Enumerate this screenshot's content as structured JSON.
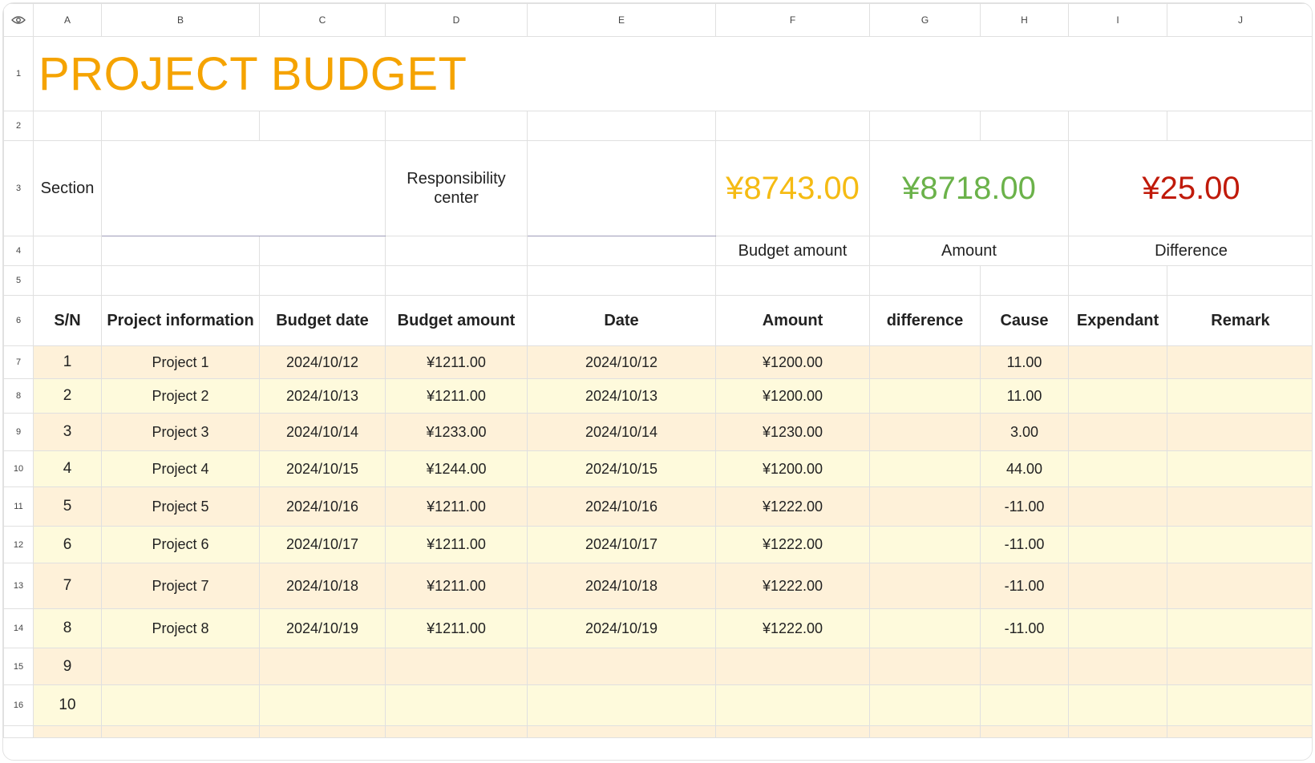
{
  "columns": [
    "A",
    "B",
    "C",
    "D",
    "E",
    "F",
    "G",
    "H",
    "I",
    "J"
  ],
  "row_numbers": [
    "1",
    "2",
    "3",
    "4",
    "5",
    "6",
    "7",
    "8",
    "9",
    "10",
    "11",
    "12",
    "13",
    "14",
    "15",
    "16"
  ],
  "sheet": {
    "title": "PROJECT BUDGET",
    "section_label": "Section",
    "responsibility_label": "Responsibility center",
    "summary": {
      "budget_amount_value": "¥8743.00",
      "amount_value": "¥8718.00",
      "difference_value": "¥25.00",
      "budget_amount_label": "Budget amount",
      "amount_label": "Amount",
      "difference_label": "Difference"
    },
    "headers": [
      "S/N",
      "Project information",
      "Budget date",
      "Budget amount",
      "Date",
      "Amount",
      "difference",
      "Cause",
      "Expendant",
      "Remark"
    ],
    "rows": [
      {
        "sn": "1",
        "project": "Project 1",
        "budget_date": "2024/10/12",
        "budget_amount": "¥1211.00",
        "date": "2024/10/12",
        "amount": "¥1200.00",
        "difference": "",
        "cause": "11.00",
        "expendant": "",
        "remark": ""
      },
      {
        "sn": "2",
        "project": "Project 2",
        "budget_date": "2024/10/13",
        "budget_amount": "¥1211.00",
        "date": "2024/10/13",
        "amount": "¥1200.00",
        "difference": "",
        "cause": "11.00",
        "expendant": "",
        "remark": ""
      },
      {
        "sn": "3",
        "project": "Project 3",
        "budget_date": "2024/10/14",
        "budget_amount": "¥1233.00",
        "date": "2024/10/14",
        "amount": "¥1230.00",
        "difference": "",
        "cause": "3.00",
        "expendant": "",
        "remark": ""
      },
      {
        "sn": "4",
        "project": "Project 4",
        "budget_date": "2024/10/15",
        "budget_amount": "¥1244.00",
        "date": "2024/10/15",
        "amount": "¥1200.00",
        "difference": "",
        "cause": "44.00",
        "expendant": "",
        "remark": ""
      },
      {
        "sn": "5",
        "project": "Project 5",
        "budget_date": "2024/10/16",
        "budget_amount": "¥1211.00",
        "date": "2024/10/16",
        "amount": "¥1222.00",
        "difference": "",
        "cause": "-11.00",
        "expendant": "",
        "remark": ""
      },
      {
        "sn": "6",
        "project": "Project 6",
        "budget_date": "2024/10/17",
        "budget_amount": "¥1211.00",
        "date": "2024/10/17",
        "amount": "¥1222.00",
        "difference": "",
        "cause": "-11.00",
        "expendant": "",
        "remark": ""
      },
      {
        "sn": "7",
        "project": "Project 7",
        "budget_date": "2024/10/18",
        "budget_amount": "¥1211.00",
        "date": "2024/10/18",
        "amount": "¥1222.00",
        "difference": "",
        "cause": "-11.00",
        "expendant": "",
        "remark": ""
      },
      {
        "sn": "8",
        "project": "Project 8",
        "budget_date": "2024/10/19",
        "budget_amount": "¥1211.00",
        "date": "2024/10/19",
        "amount": "¥1222.00",
        "difference": "",
        "cause": "-11.00",
        "expendant": "",
        "remark": ""
      },
      {
        "sn": "9",
        "project": "",
        "budget_date": "",
        "budget_amount": "",
        "date": "",
        "amount": "",
        "difference": "",
        "cause": "",
        "expendant": "",
        "remark": ""
      },
      {
        "sn": "10",
        "project": "",
        "budget_date": "",
        "budget_amount": "",
        "date": "",
        "amount": "",
        "difference": "",
        "cause": "",
        "expendant": "",
        "remark": ""
      }
    ]
  },
  "icons": {
    "corner": "eye-icon"
  },
  "colors": {
    "title": "#f5a300",
    "budget": "#f5bb13",
    "amount": "#6bb24a",
    "difference": "#c01a0a",
    "row_odd": "#fef1d9",
    "row_even": "#fefadc",
    "rule": "#c8967c"
  }
}
